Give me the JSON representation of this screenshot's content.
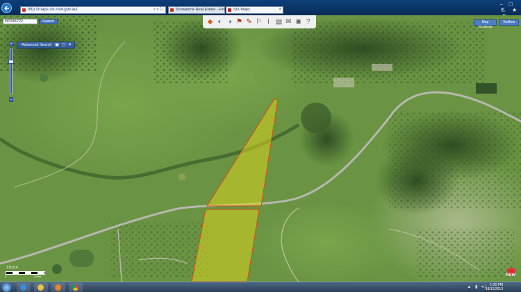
{
  "browser": {
    "address_url": "http://maps.six.nsw.gov.au/",
    "tabs": [
      {
        "label": "Snowstone Real Estate - Find Yo..."
      },
      {
        "label": "SIX Maps"
      }
    ],
    "window_controls": "– ▢ ✕",
    "home_star_gear": "⌂ ★ ⚙"
  },
  "map_app": {
    "search": {
      "value": "DP245722",
      "button_label": "Search"
    },
    "buttons": {
      "map_contents": "Map Contents",
      "toolbox": "Toolbox"
    },
    "advanced_search": {
      "label": "Advanced Search",
      "controls": "▣ ▢ ✕"
    },
    "zoom": {
      "in": "+",
      "out": "–"
    },
    "scale": {
      "label": "1:8,514",
      "start": "0",
      "end": "200m"
    },
    "logo": {
      "text": "NSW"
    }
  },
  "toolbar_icons": [
    "measure-icon",
    "globe-icon",
    "globe-icon",
    "pin-icon",
    "draw-icon",
    "flag-icon",
    "info-icon",
    "print-icon",
    "share-icon",
    "camera-icon",
    "help-icon"
  ],
  "taskbar": {
    "time": "1:05 PM",
    "date": "18/12/2013"
  },
  "colors": {
    "parcel_fill": "#d9d21f",
    "parcel_outline": "#d64a16",
    "road": "#b8b8b0"
  }
}
